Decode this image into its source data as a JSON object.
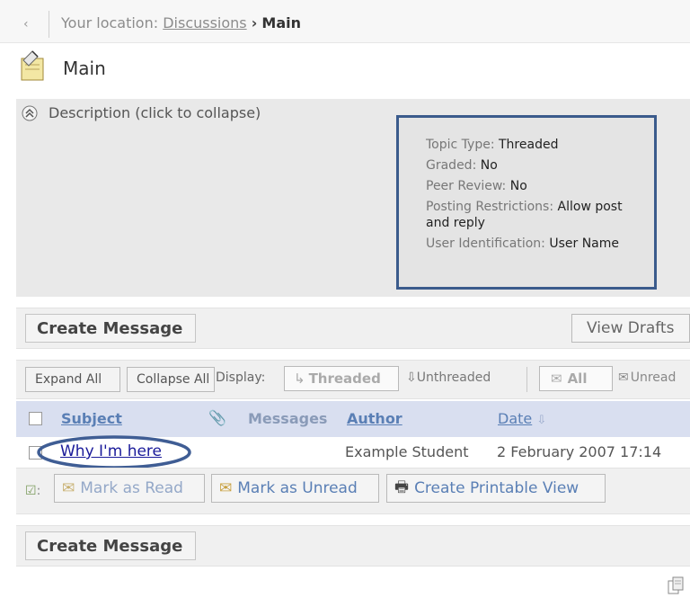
{
  "breadcrumb": {
    "prefix": "Your location:",
    "link": "Discussions",
    "separator": "›",
    "current": "Main"
  },
  "page_title": "Main",
  "description": {
    "toggle_label": "Description (click to collapse)",
    "info": [
      {
        "label": "Topic Type:",
        "value": "Threaded"
      },
      {
        "label": "Graded:",
        "value": "No"
      },
      {
        "label": "Peer Review:",
        "value": "No"
      },
      {
        "label": "Posting Restrictions:",
        "value": "Allow post and reply"
      },
      {
        "label": "User Identification:",
        "value": "User Name"
      }
    ]
  },
  "toolbar": {
    "create_message": "Create Message",
    "view_drafts": "View Drafts"
  },
  "filterbar": {
    "expand_all": "Expand All",
    "collapse_all": "Collapse All",
    "display_label": "Display:",
    "threaded": "Threaded",
    "unthreaded": "Unthreaded",
    "all": "All",
    "unread": "Unread"
  },
  "table": {
    "headers": {
      "subject": "Subject",
      "messages": "Messages",
      "author": "Author",
      "date": "Date"
    },
    "rows": [
      {
        "subject": "Why I'm here",
        "author": "Example Student",
        "date": "2 February 2007 17:14"
      }
    ]
  },
  "actions": {
    "mark_read": "Mark as Read",
    "mark_unread": "Mark as Unread",
    "printable": "Create Printable View"
  },
  "bottom": {
    "create_message": "Create Message"
  },
  "colors": {
    "header_row": "#d9dff0",
    "info_border": "#3b5b8c",
    "highlight_ellipse": "#3f5d94",
    "link": "#1a1a9a"
  }
}
